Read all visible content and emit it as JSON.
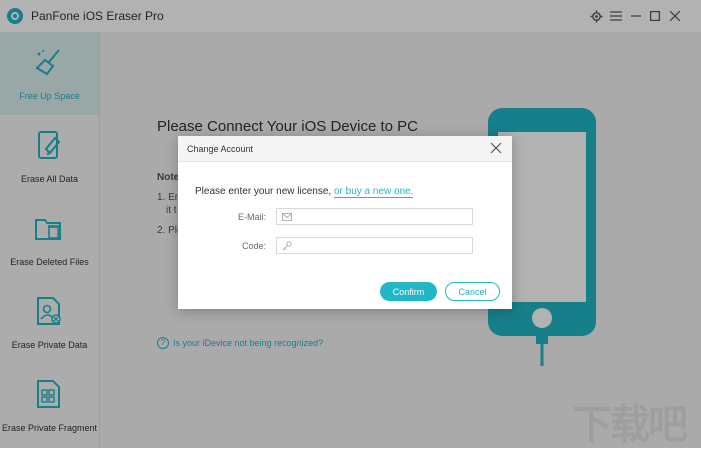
{
  "app": {
    "title": "PanFone iOS Eraser Pro",
    "accent_color": "#22b7c6"
  },
  "titlebar": {
    "icons": [
      "gear-icon",
      "menu-icon",
      "minimize-icon",
      "maximize-icon",
      "close-icon"
    ]
  },
  "sidebar": {
    "items": [
      {
        "label": "Free Up Space",
        "icon": "broom-icon",
        "active": true
      },
      {
        "label": "Erase All Data",
        "icon": "phone-erase-icon",
        "active": false
      },
      {
        "label": "Erase Deleted Files",
        "icon": "folder-trash-icon",
        "active": false
      },
      {
        "label": "Erase Private Data",
        "icon": "private-data-icon",
        "active": false
      },
      {
        "label": "Erase Private Fragment",
        "icon": "fragment-icon",
        "active": false
      }
    ]
  },
  "main": {
    "heading": "Please Connect Your iOS Device to PC",
    "notes_title": "Note",
    "notes_line1": "1. En",
    "notes_line1b": "it t",
    "notes_line2": "2. Ple",
    "help_link": "Is your iDevice not being recognized?"
  },
  "dialog": {
    "title": "Change Account",
    "prompt": "Please enter your new license,",
    "prompt_link": "or buy a new one.",
    "email_label": "E-Mail:",
    "email_value": "",
    "code_label": "Code:",
    "code_value": "",
    "confirm_label": "Confirm",
    "cancel_label": "Cancel"
  },
  "watermark": {
    "text": "下载吧"
  }
}
